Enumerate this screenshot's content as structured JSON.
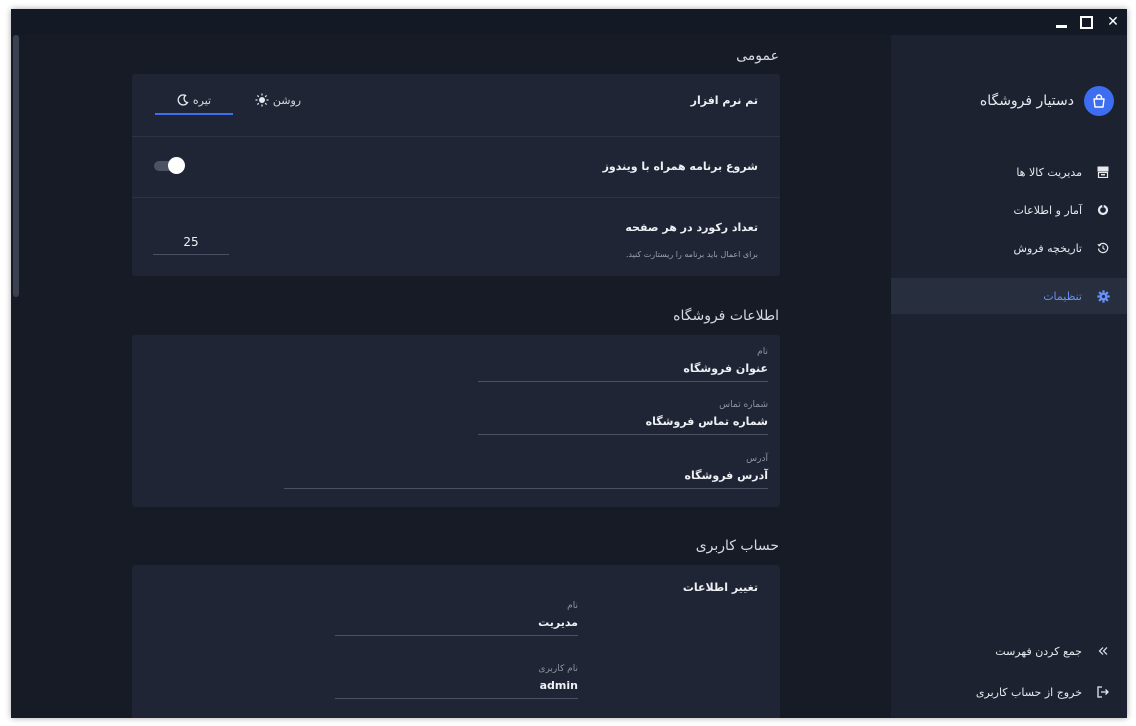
{
  "window": {
    "minimize_label": "Minimize",
    "maximize_label": "Maximize",
    "close_glyph": "✕"
  },
  "sidebar": {
    "app_name": "دستیار فروشگاه",
    "logo_icon": "shopping-bag-icon",
    "items": [
      {
        "label": "مدیریت کالا ها",
        "icon": "inventory-icon",
        "active": false
      },
      {
        "label": "آمار و اطلاعات",
        "icon": "pie-chart-icon",
        "active": false
      },
      {
        "label": "تاریخچه فروش",
        "icon": "history-icon",
        "active": false
      },
      {
        "label": "تنظیمات",
        "icon": "gear-icon",
        "active": true
      }
    ],
    "collapse_label": "جمع کردن فهرست",
    "logout_label": "خروج از حساب کاربری"
  },
  "general": {
    "title": "عمومی",
    "theme": {
      "label": "تم نرم افزار",
      "options": [
        {
          "label": "روشن",
          "icon": "sun-icon"
        },
        {
          "label": "تیره",
          "icon": "moon-icon"
        }
      ],
      "selected": "تیره"
    },
    "startup": {
      "label": "شروع برنامه همراه با ویندوز",
      "enabled": true
    },
    "records": {
      "label": "تعداد رکورد در هر صفحه",
      "hint": "برای اعمال باید برنامه را ریستارت کنید.",
      "value": "25"
    }
  },
  "store_info": {
    "title": "اطلاعات فروشگاه",
    "fields": [
      {
        "label": "نام",
        "value": "عنوان فروشگاه"
      },
      {
        "label": "شماره تماس",
        "value": "شماره تماس فروشگاه"
      },
      {
        "label": "آدرس",
        "value": "آدرس فروشگاه"
      }
    ]
  },
  "account": {
    "title": "حساب کاربری",
    "subtitle": "تغییر اطلاعات",
    "fields": [
      {
        "label": "نام",
        "value": "مدیریت"
      },
      {
        "label": "نام کاربری",
        "value": "admin"
      }
    ]
  },
  "colors": {
    "accent": "#3d6df0",
    "background": "#161b26",
    "card": "#1f2534",
    "sidebar": "#1c2230"
  }
}
